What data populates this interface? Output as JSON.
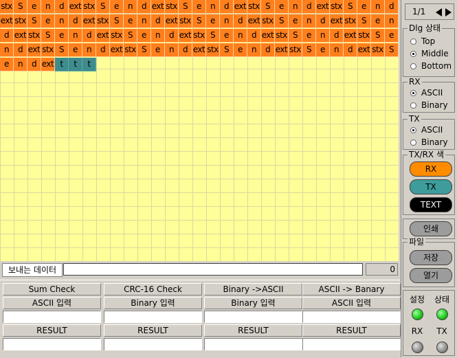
{
  "grid": {
    "rows": [
      [
        "stx",
        "S",
        "e",
        "n",
        "d",
        "ext",
        "stx",
        "S",
        "e",
        "n",
        "d",
        "ext",
        "stx",
        "S",
        "e",
        "n",
        "d",
        "ext",
        "stx",
        "S",
        "e",
        "n",
        "d",
        "ext",
        "stx",
        "S",
        "e",
        "n",
        "d"
      ],
      [
        "ext",
        "stx",
        "S",
        "e",
        "n",
        "d",
        "ext",
        "stx",
        "S",
        "e",
        "n",
        "d",
        "ext",
        "stx",
        "S",
        "e",
        "n",
        "d",
        "ext",
        "stx",
        "S",
        "e",
        "n",
        "d",
        "ext",
        "stx",
        "S",
        "e",
        "n"
      ],
      [
        "d",
        "ext",
        "stx",
        "S",
        "e",
        "n",
        "d",
        "ext",
        "stx",
        "S",
        "e",
        "n",
        "d",
        "ext",
        "stx",
        "S",
        "e",
        "n",
        "d",
        "ext",
        "stx",
        "S",
        "e",
        "n",
        "d",
        "ext",
        "stx",
        "S",
        "e"
      ],
      [
        "n",
        "d",
        "ext",
        "stx",
        "S",
        "e",
        "n",
        "d",
        "ext",
        "stx",
        "S",
        "e",
        "n",
        "d",
        "ext",
        "stx",
        "S",
        "e",
        "n",
        "d",
        "ext",
        "stx",
        "S",
        "e",
        "n",
        "d",
        "ext",
        "stx",
        "S"
      ],
      [
        "e",
        "n",
        "d",
        "ext",
        "t",
        "t",
        "t"
      ]
    ],
    "tx_cells_last_row": [
      4,
      5,
      6
    ],
    "colors": {
      "rx": "#ff7f1c",
      "tx": "#3e8c8c",
      "background": "#ffff99"
    }
  },
  "send": {
    "label": "보내는 데이터",
    "value": "",
    "count": "0"
  },
  "panels": [
    {
      "title": "Sum Check",
      "input_label": "ASCII 입력",
      "result_label": "RESULT"
    },
    {
      "title": "CRC-16 Check",
      "input_label": "Binary 입력",
      "result_label": "RESULT"
    },
    {
      "title": "Binary ->ASCII",
      "input_label": "Binary 입력",
      "result_label": "RESULT"
    },
    {
      "title": "ASCII -> Banary",
      "input_label": "ASCII 입력",
      "result_label": "RESULT"
    }
  ],
  "right": {
    "page": "1/1",
    "dlg": {
      "title": "Dlg 상태",
      "options": [
        "Top",
        "Middle",
        "Bottom"
      ],
      "selected": "Middle"
    },
    "rx": {
      "title": "RX",
      "options": [
        "ASCII",
        "Binary"
      ],
      "selected": "ASCII"
    },
    "tx": {
      "title": "TX",
      "options": [
        "ASCII",
        "Binary"
      ],
      "selected": "ASCII"
    },
    "colors": {
      "title": "TX/RX 색",
      "rx_label": "RX",
      "tx_label": "TX",
      "text_label": "TEXT",
      "rx_color": "#ff8c00",
      "tx_color": "#3e9c9c",
      "text_color": "#000000"
    },
    "print_label": "인쇄",
    "file": {
      "title": "파일",
      "save_label": "저장",
      "open_label": "열기"
    },
    "status": {
      "setup_label": "설정",
      "state_label": "상태",
      "rx_label": "RX",
      "tx_label": "TX"
    }
  }
}
